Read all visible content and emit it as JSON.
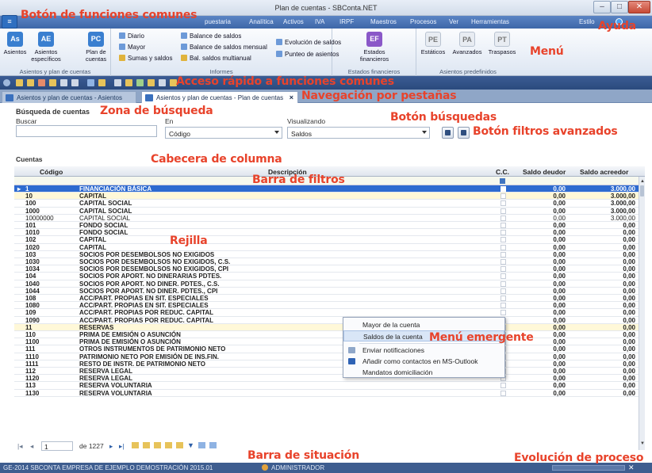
{
  "window": {
    "title": "Plan de cuentas - SBConta.NET"
  },
  "menubar": {
    "items": [
      "puestaria",
      "Analítica",
      "Activos",
      "IVA",
      "IRPF",
      "Maestros",
      "Procesos",
      "Ver",
      "Herramientas"
    ],
    "style_label": "Estilo"
  },
  "ribbon": {
    "groups": [
      {
        "label": "Asientos y plan de cuentas"
      },
      {
        "label": "Informes"
      },
      {
        "label": "Estados financieros"
      },
      {
        "label": "Asientos predefinidos"
      }
    ],
    "buttons": {
      "asientos": {
        "icon": "As",
        "label": "Asientos"
      },
      "asientos_especificos": {
        "icon": "AE",
        "label1": "Asientos",
        "label2": "específicos"
      },
      "plan_cuentas": {
        "icon": "PC",
        "label1": "Plan de",
        "label2": "cuentas"
      },
      "diario": "Diario",
      "mayor": "Mayor",
      "sumas_saldos": "Sumas y saldos",
      "balance_saldos": "Balance de saldos",
      "balance_mensual": "Balance de saldos mensual",
      "bal_multianual": "Bal. saldos multianual",
      "evolucion_saldos": "Evolución de saldos",
      "punteo_asientos": "Punteo de asientos",
      "estados_financieros": {
        "icon": "EF",
        "label1": "Estados",
        "label2": "financieros"
      },
      "estaticos": {
        "icon": "PE",
        "label": "Estáticos"
      },
      "avanzados": {
        "icon": "PA",
        "label": "Avanzados"
      },
      "traspasos": {
        "icon": "PT",
        "label": "Traspasos"
      }
    }
  },
  "tabs": [
    {
      "label": "Asientos y plan de cuentas - Asientos"
    },
    {
      "label": "Asientos y plan de cuentas - Plan de cuentas",
      "close": "×"
    }
  ],
  "search": {
    "title": "Búsqueda de cuentas",
    "buscar_label": "Buscar",
    "buscar_value": "",
    "en_label": "En",
    "en_value": "Código",
    "visualizando_label": "Visualizando",
    "visualizando_value": "Saldos"
  },
  "grid": {
    "section_label": "Cuentas",
    "columns": [
      "Código",
      "Descripción",
      "C.C.",
      "Saldo deudor",
      "Saldo acreedor"
    ],
    "rows": [
      {
        "code": "1",
        "desc": "FINANCIACIÓN BÁSICA",
        "deudor": "0,00",
        "acreedor": "3.000,00",
        "bold": true,
        "sel": true
      },
      {
        "code": "10",
        "desc": "CAPITAL",
        "deudor": "0,00",
        "acreedor": "3.000,00",
        "bold": true,
        "yellow": true
      },
      {
        "code": "100",
        "desc": "CAPITAL SOCIAL",
        "deudor": "0,00",
        "acreedor": "3.000,00",
        "bold": true
      },
      {
        "code": "1000",
        "desc": "CAPITAL SOCIAL",
        "deudor": "0,00",
        "acreedor": "3.000,00",
        "bold": true
      },
      {
        "code": "10000000",
        "desc": "CAPITAL SOCIAL",
        "deudor": "0,00",
        "acreedor": "3.000,00",
        "bold": false
      },
      {
        "code": "101",
        "desc": "FONDO SOCIAL",
        "deudor": "0,00",
        "acreedor": "0,00",
        "bold": true
      },
      {
        "code": "1010",
        "desc": "FONDO SOCIAL",
        "deudor": "0,00",
        "acreedor": "0,00",
        "bold": true
      },
      {
        "code": "102",
        "desc": "CAPITAL",
        "deudor": "0,00",
        "acreedor": "0,00",
        "bold": true
      },
      {
        "code": "1020",
        "desc": "CAPITAL",
        "deudor": "0,00",
        "acreedor": "0,00",
        "bold": true
      },
      {
        "code": "103",
        "desc": "SOCIOS POR DESEMBOLSOS NO EXIGIDOS",
        "deudor": "0,00",
        "acreedor": "0,00",
        "bold": true
      },
      {
        "code": "1030",
        "desc": "SOCIOS POR DESEMBOLSOS NO EXIGIDOS, C.S.",
        "deudor": "0,00",
        "acreedor": "0,00",
        "bold": true
      },
      {
        "code": "1034",
        "desc": "SOCIOS POR DESEMBOLSOS NO EXIGIDOS, CPI",
        "deudor": "0,00",
        "acreedor": "0,00",
        "bold": true
      },
      {
        "code": "104",
        "desc": "SOCIOS POR APORT. NO DINERARIAS PDTES.",
        "deudor": "0,00",
        "acreedor": "0,00",
        "bold": true
      },
      {
        "code": "1040",
        "desc": "SOCIOS POR APORT. NO DINER. PDTES., C.S.",
        "deudor": "0,00",
        "acreedor": "0,00",
        "bold": true
      },
      {
        "code": "1044",
        "desc": "SOCIOS POR APORT. NO DINER. PDTES., CPI",
        "deudor": "0,00",
        "acreedor": "0,00",
        "bold": true
      },
      {
        "code": "108",
        "desc": "ACC/PART. PROPIAS EN SIT. ESPECIALES",
        "deudor": "0,00",
        "acreedor": "0,00",
        "bold": true
      },
      {
        "code": "1080",
        "desc": "ACC/PART. PROPIAS EN SIT. ESPECIALES",
        "deudor": "0,00",
        "acreedor": "0,00",
        "bold": true
      },
      {
        "code": "109",
        "desc": "ACC/PART. PROPIAS POR REDUC. CAPITAL",
        "deudor": "0,00",
        "acreedor": "0,00",
        "bold": true
      },
      {
        "code": "1090",
        "desc": "ACC/PART. PROPIAS POR REDUC. CAPITAL",
        "deudor": "0,00",
        "acreedor": "0,00",
        "bold": true
      },
      {
        "code": "11",
        "desc": "RESERVAS",
        "deudor": "0,00",
        "acreedor": "0,00",
        "bold": true,
        "yellow": true
      },
      {
        "code": "110",
        "desc": "PRIMA DE EMISIÓN O ASUNCIÓN",
        "deudor": "0,00",
        "acreedor": "0,00",
        "bold": true
      },
      {
        "code": "1100",
        "desc": "PRIMA DE EMISIÓN O ASUNCIÓN",
        "deudor": "0,00",
        "acreedor": "0,00",
        "bold": true
      },
      {
        "code": "111",
        "desc": "OTROS INSTRUMENTOS DE PATRIMONIO NETO",
        "deudor": "0,00",
        "acreedor": "0,00",
        "bold": true
      },
      {
        "code": "1110",
        "desc": "PATRIMONIO NETO POR EMISIÓN DE INS.FIN.",
        "deudor": "0,00",
        "acreedor": "0,00",
        "bold": true
      },
      {
        "code": "1111",
        "desc": "RESTO DE INSTR. DE PATRIMONIO NETO",
        "deudor": "0,00",
        "acreedor": "0,00",
        "bold": true
      },
      {
        "code": "112",
        "desc": "RESERVA LEGAL",
        "deudor": "0,00",
        "acreedor": "0,00",
        "bold": true
      },
      {
        "code": "1120",
        "desc": "RESERVA LEGAL",
        "deudor": "0,00",
        "acreedor": "0,00",
        "bold": true
      },
      {
        "code": "113",
        "desc": "RESERVA VOLUNTARIA",
        "deudor": "0,00",
        "acreedor": "0,00",
        "bold": true
      },
      {
        "code": "1130",
        "desc": "RESERVA VOLUNTARIA",
        "deudor": "0,00",
        "acreedor": "0,00",
        "bold": true
      }
    ]
  },
  "context_menu": {
    "items": [
      "Mayor de la cuenta",
      "Saldos de la cuenta",
      "Enviar notificaciones",
      "Añadir como contactos en MS-Outlook",
      "Mandatos domiciliación"
    ],
    "highlighted": 1
  },
  "navigator": {
    "current": "1",
    "total": "de 1227"
  },
  "status": {
    "left": "GE-2014  SBCONTA EMPRESA DE EJEMPLO  DEMOSTRACIÓN 2015.01",
    "user": "ADMINISTRADOR"
  },
  "annotations": {
    "funciones_comunes": "Botón de funciones comunes",
    "ayuda": "Ayuda",
    "menu": "Menú",
    "acceso_rapido": "Acceso rápido a funciones comunes",
    "navegacion": "Navegación por pestañas",
    "zona_busqueda": "Zona de búsqueda",
    "boton_busquedas": "Botón búsquedas",
    "filtros_avanzados": "Botón filtros avanzados",
    "cabecera": "Cabecera de columna",
    "barra_filtros": "Barra de filtros",
    "rejilla": "Rejilla",
    "menu_emergente": "Menú emergente",
    "barra_situacion": "Barra de situación",
    "evolucion_proceso": "Evolución de proceso"
  },
  "colors": {
    "annotation": "#e8432b",
    "accent": "#2d6ad0",
    "menubar": "#4a74b6",
    "status": "#3e5d8f"
  }
}
